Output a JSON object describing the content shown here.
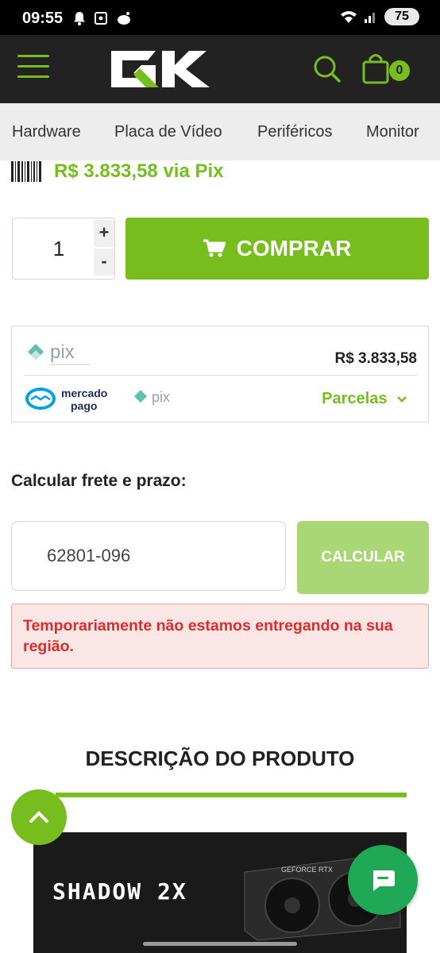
{
  "status_bar": {
    "time": "09:55",
    "battery": "75"
  },
  "header": {
    "logo_text": "GK",
    "cart_count": "0",
    "accent_color": "#76bd1d",
    "background": "#222222"
  },
  "categories": [
    "Hardware",
    "Placa de Vídeo",
    "Periféricos",
    "Monitor"
  ],
  "product": {
    "pix_price_label": "R$ 3.833,58 via Pix",
    "quantity": "1",
    "qty_plus": "+",
    "qty_minus": "-",
    "buy_label": "COMPRAR"
  },
  "payment": {
    "pix_price": "R$ 3.833,58",
    "parcelas_label": "Parcelas"
  },
  "shipping": {
    "label": "Calcular frete e prazo:",
    "cep_value": "62801-096",
    "calc_label": "CALCULAR",
    "error": "Temporariamente não estamos entregando na sua região."
  },
  "description": {
    "title": "DESCRIÇÃO DO PRODUTO",
    "banner_text": "SHADOW 2X"
  },
  "icons": {
    "menu": "menu-icon",
    "search": "search-icon",
    "cart": "cart-icon",
    "scroll_top": "chevron-up-icon",
    "chat": "chat-icon"
  }
}
